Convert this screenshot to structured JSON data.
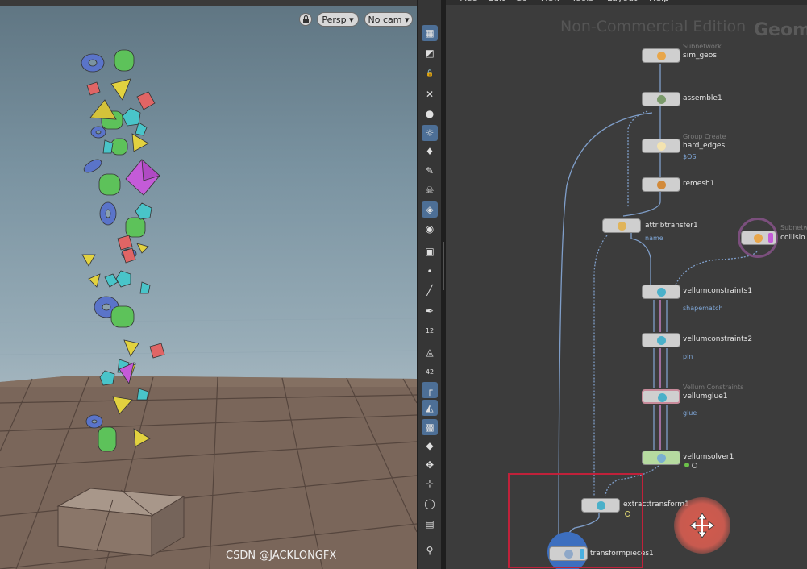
{
  "viewport": {
    "camera_persp_label": "Persp",
    "camera_cam_label": "No cam",
    "lock_icon": "lock-icon",
    "dropdown_glyph": "▾"
  },
  "shelf": {
    "icons": [
      "view-icon",
      "select-icon",
      "lock-icon",
      "handle-icon",
      "sphere-icon",
      "light-icon",
      "bulb-icon",
      "paint-icon",
      "skull-icon",
      "layers-icon",
      "eye-icon",
      "camera-icon",
      "dot-icon",
      "brush-icon",
      "pen-icon",
      "num-12-icon",
      "paint-bucket-icon",
      "num-42-icon",
      "corner-icon",
      "active-tool-icon",
      "grid-icon",
      "snap-icon",
      "transform-icon",
      "scale-icon",
      "circle-icon",
      "display-icon",
      "pin-icon"
    ],
    "active_indices": [
      0,
      5,
      9,
      18,
      19,
      20
    ]
  },
  "network": {
    "menus": [
      "Add",
      "Edit",
      "Go",
      "View",
      "Tools",
      "Layout",
      "Help"
    ],
    "watermark_left": "Non-Commercial Edition",
    "watermark_right": "Geom",
    "nodes": {
      "sim_geos": {
        "type": "Subnetwork",
        "label": "sim_geos"
      },
      "assemble1": {
        "label": "assemble1"
      },
      "hard_edges": {
        "type": "Group Create",
        "label": "hard_edges",
        "parm": "$OS"
      },
      "remesh1": {
        "label": "remesh1"
      },
      "attribtransfer1": {
        "label": "attribtransfer1",
        "parm": "name"
      },
      "collision": {
        "type": "Subnetw",
        "label": "collisio"
      },
      "vellumconstraints1": {
        "label": "vellumconstraints1",
        "parm": "shapematch"
      },
      "vellumconstraints2": {
        "label": "vellumconstraints2",
        "parm": "pin"
      },
      "vellumglue1": {
        "type": "Vellum Constraints",
        "label": "vellumglue1",
        "parm": "glue"
      },
      "vellumsolver1": {
        "label": "vellumsolver1"
      },
      "extracttransform1": {
        "label": "extracttransform1"
      },
      "transformpieces1": {
        "label": "transformpieces1"
      }
    },
    "colors": {
      "wire": "#7f9ec9",
      "wire_pink": "#d88ad6",
      "highlight_box": "#c0213a",
      "display_flag": "#3d6fbf"
    },
    "move_icon": "move-arrows-icon"
  },
  "watermark": "CSDN @JACKLONGFX"
}
